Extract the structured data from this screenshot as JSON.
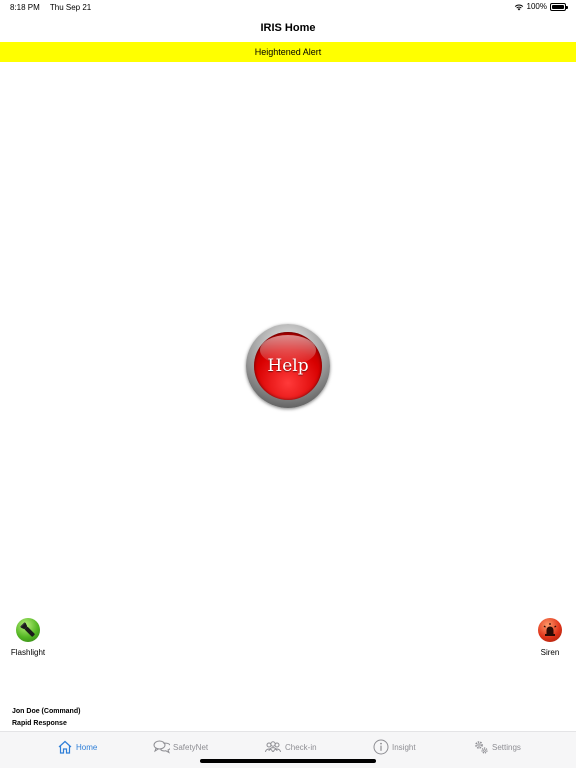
{
  "status_bar": {
    "time": "8:18 PM",
    "date": "Thu Sep 21",
    "battery_percent": "100%",
    "battery_level": 1.0
  },
  "nav": {
    "title": "IRIS Home"
  },
  "alert": {
    "text": "Heightened Alert",
    "color": "#ffff00"
  },
  "help_button": {
    "label": "Help"
  },
  "actions": {
    "flashlight": "Flashlight",
    "siren": "Siren"
  },
  "user": {
    "name": "Jon Doe (Command)",
    "team": "Rapid Response"
  },
  "tabs": [
    {
      "label": "Home",
      "icon": "home-icon",
      "active": true
    },
    {
      "label": "SafetyNet",
      "icon": "chat-bubbles-icon",
      "active": false
    },
    {
      "label": "Check-in",
      "icon": "people-icon",
      "active": false
    },
    {
      "label": "Insight",
      "icon": "info-icon",
      "active": false
    },
    {
      "label": "Settings",
      "icon": "gears-icon",
      "active": false
    }
  ],
  "colors": {
    "accent": "#2f7fd8",
    "inactive": "#8e8e93",
    "help_red": "#d80000"
  }
}
